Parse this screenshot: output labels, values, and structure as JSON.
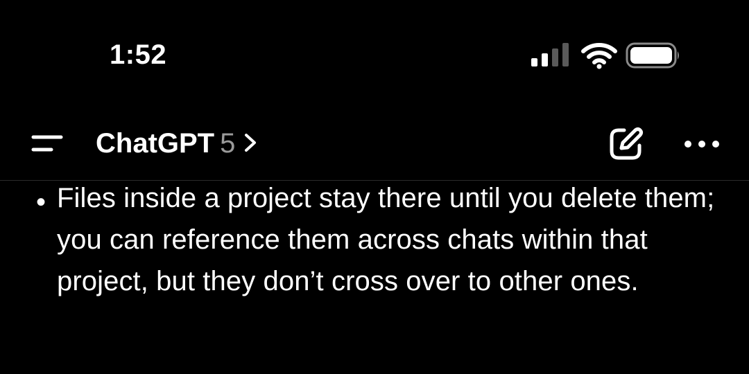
{
  "status_bar": {
    "time": "1:52",
    "icons": [
      "cellular-signal-icon",
      "wifi-icon",
      "battery-icon"
    ]
  },
  "header": {
    "title": "ChatGPT",
    "version": "5",
    "icons": [
      "menu-icon",
      "chevron-right-icon",
      "new-chat-icon",
      "more-options-icon"
    ]
  },
  "conversation": {
    "bullet": "•",
    "text": "Files inside a project stay there until you delete them; you can reference them across chats within that project, but they don’t cross over to other ones."
  },
  "colors": {
    "background": "#000000",
    "text": "#ffffff",
    "muted": "#9a9a9a",
    "signal_inactive": "#5a5a5a"
  }
}
